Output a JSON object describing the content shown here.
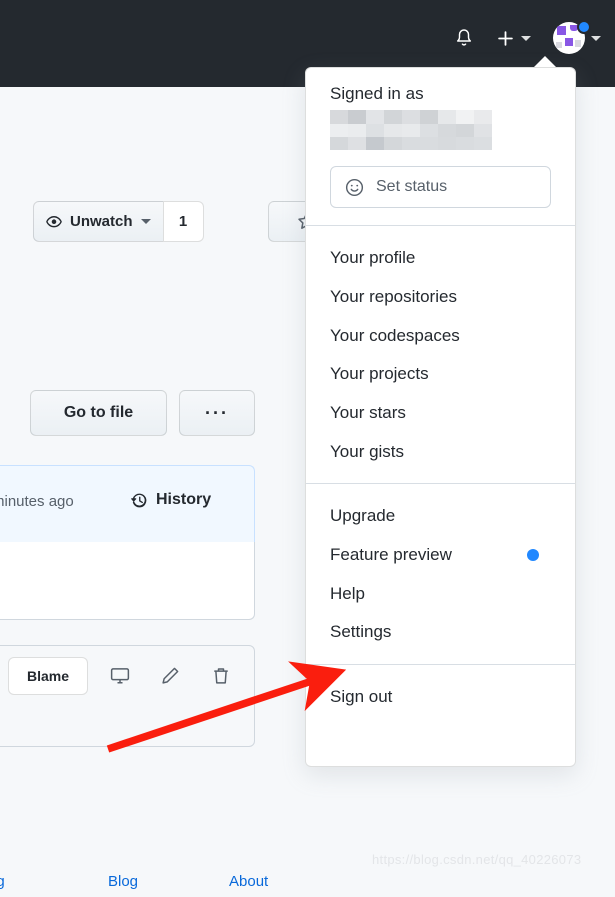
{
  "topbar": {
    "background_color": "#24292f",
    "notifications_icon": "bell-icon",
    "create_new_icon": "plus-icon",
    "avatar_icon": "user-avatar",
    "notification_dot_color": "#2188ff"
  },
  "repo_page": {
    "watch_button": {
      "label": "Unwatch",
      "icon": "eye-icon",
      "count": "1"
    },
    "star_button": {
      "icon": "star-icon"
    },
    "go_to_file_button": "Go to file",
    "more_options_button": "···",
    "commit_panel": {
      "time_text": "minutes ago",
      "history_label": "History",
      "history_icon": "history-clock-icon",
      "background_color": "#f1f8ff"
    },
    "file_toolbar": {
      "blame_label": "Blame",
      "desktop_icon": "desktop-download-icon",
      "edit_icon": "pencil-icon",
      "delete_icon": "trash-icon"
    },
    "footer_links": [
      "ng",
      "Blog",
      "About"
    ],
    "footer_link_color": "#0969da"
  },
  "user_dropdown": {
    "signed_in_as_label": "Signed in as",
    "username_redacted": true,
    "set_status": {
      "label": "Set status",
      "icon": "smiley-icon"
    },
    "groups": [
      {
        "items": [
          {
            "label": "Your profile",
            "badge": null
          },
          {
            "label": "Your repositories",
            "badge": null
          },
          {
            "label": "Your codespaces",
            "badge": null
          },
          {
            "label": "Your projects",
            "badge": null
          },
          {
            "label": "Your stars",
            "badge": null
          },
          {
            "label": "Your gists",
            "badge": null
          }
        ]
      },
      {
        "items": [
          {
            "label": "Upgrade",
            "badge": null
          },
          {
            "label": "Feature preview",
            "badge": "dot"
          },
          {
            "label": "Help",
            "badge": null
          },
          {
            "label": "Settings",
            "badge": null
          }
        ]
      },
      {
        "items": [
          {
            "label": "Sign out",
            "badge": null
          }
        ]
      }
    ]
  },
  "annotation": {
    "arrow_color": "#fa1e0e",
    "points_at": "Settings"
  },
  "watermark": {
    "text": "https://blog.csdn.net/qq_40226073"
  }
}
